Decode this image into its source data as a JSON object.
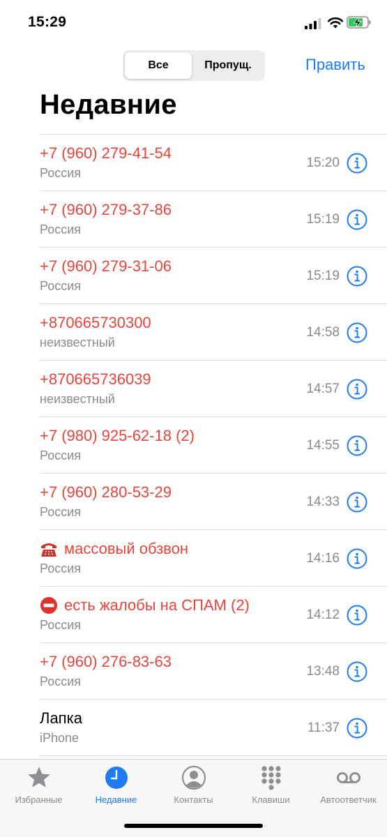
{
  "status_bar": {
    "time": "15:29",
    "icons": [
      "cellular-signal-icon",
      "wifi-icon",
      "battery-charging-icon"
    ]
  },
  "segment": {
    "all_label": "Все",
    "missed_label": "Пропущ.",
    "selected": "all"
  },
  "edit_label": "Править",
  "title": "Недавние",
  "calls": [
    {
      "name": "+7 (960) 279-41-54",
      "sub": "Россия",
      "time": "15:20",
      "missed": true
    },
    {
      "name": "+7 (960) 279-37-86",
      "sub": "Россия",
      "time": "15:19",
      "missed": true
    },
    {
      "name": "+7 (960) 279-31-06",
      "sub": "Россия",
      "time": "15:19",
      "missed": true
    },
    {
      "name": "+870665730300",
      "sub": "неизвестный",
      "time": "14:58",
      "missed": true
    },
    {
      "name": "+870665736039",
      "sub": "неизвестный",
      "time": "14:57",
      "missed": true
    },
    {
      "name": "+7 (980) 925-62-18 (2)",
      "sub": "Россия",
      "time": "14:55",
      "missed": true
    },
    {
      "name": "+7 (960) 280-53-29",
      "sub": "Россия",
      "time": "14:33",
      "missed": true
    },
    {
      "name": "массовый обзвон",
      "sub": "Россия",
      "time": "14:16",
      "missed": true,
      "icon": "telephone-emoji-icon"
    },
    {
      "name": "есть жалобы на СПАМ (2)",
      "sub": "Россия",
      "time": "14:12",
      "missed": true,
      "icon": "no-entry-emoji-icon"
    },
    {
      "name": "+7 (960) 276-83-63",
      "sub": "Россия",
      "time": "13:48",
      "missed": true
    },
    {
      "name": "Лапка",
      "sub": "iPhone",
      "time": "11:37",
      "missed": false
    }
  ],
  "tabs": [
    {
      "label": "Избранные",
      "icon": "star-icon"
    },
    {
      "label": "Недавние",
      "icon": "clock-icon",
      "active": true
    },
    {
      "label": "Контакты",
      "icon": "person-circle-icon"
    },
    {
      "label": "Клавиши",
      "icon": "keypad-icon"
    },
    {
      "label": "Автоответчик",
      "icon": "voicemail-icon"
    }
  ],
  "colors": {
    "accent": "#1e7bf2",
    "missed": "#e5463b",
    "secondary_text": "#8a8a8e"
  }
}
